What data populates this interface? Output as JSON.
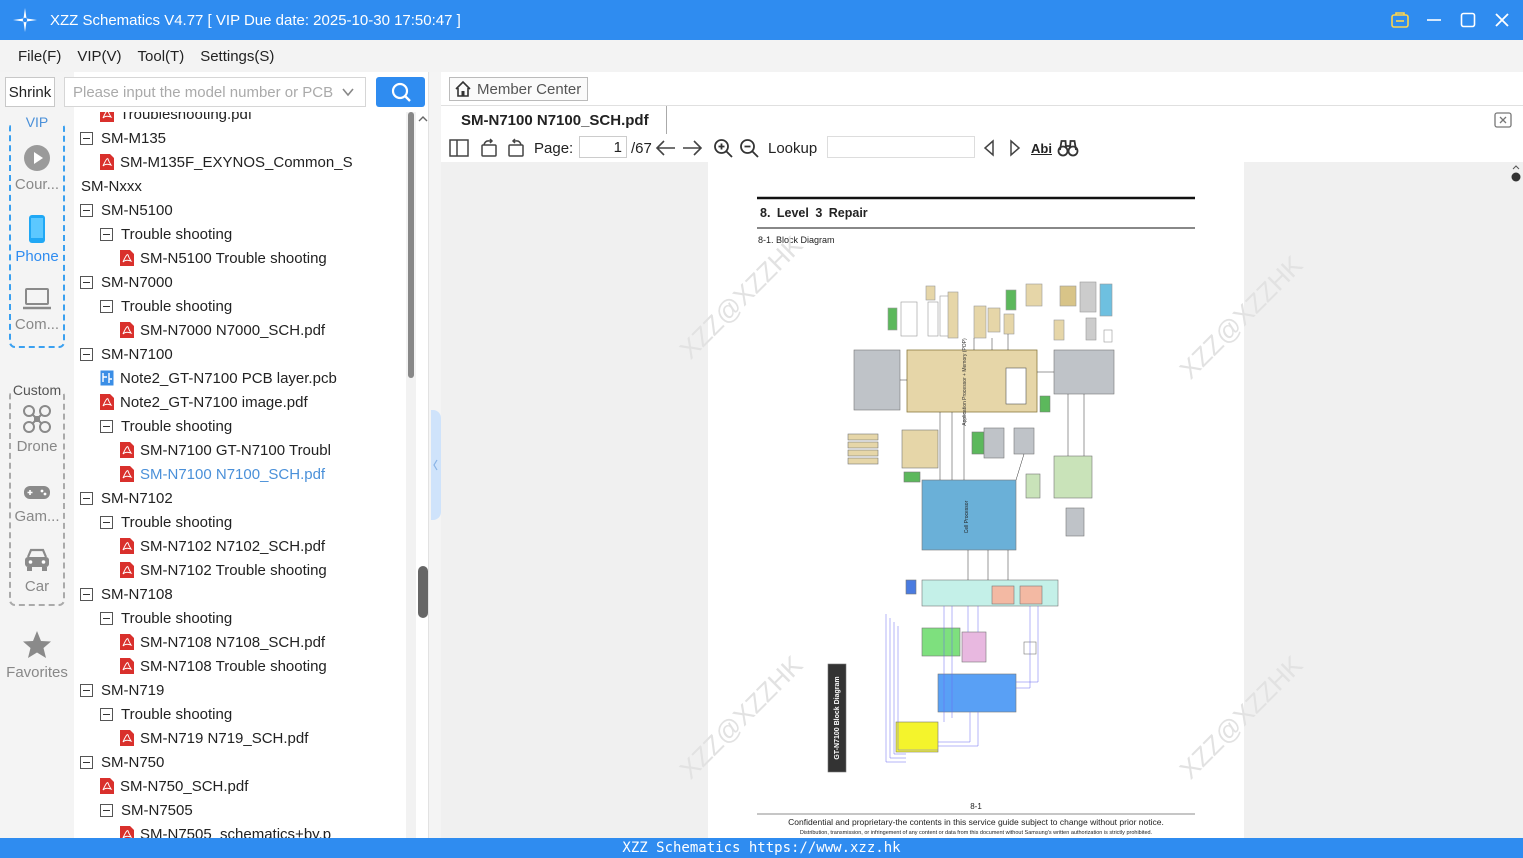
{
  "app": {
    "title": "XZZ Schematics V4.77 [ VIP Due date: 2025-10-30 17:50:47 ]"
  },
  "menu": [
    "File(F)",
    "VIP(V)",
    "Tool(T)",
    "Settings(S)"
  ],
  "rail": {
    "shrink_label": "Shrink",
    "vip_label": "VIP",
    "custom_label": "Custom",
    "items": [
      {
        "label": "Cour...",
        "icon": "play-circle-icon"
      },
      {
        "label": "Phone",
        "icon": "phone-icon"
      },
      {
        "label": "Com...",
        "icon": "laptop-icon"
      },
      {
        "label": "Drone",
        "icon": "drone-icon"
      },
      {
        "label": "Gam...",
        "icon": "gamepad-icon"
      },
      {
        "label": "Car",
        "icon": "car-icon"
      },
      {
        "label": "Favorites",
        "icon": "star-icon"
      }
    ]
  },
  "search": {
    "placeholder": "Please input the model number or PCB"
  },
  "tree": [
    {
      "label": "Troubleshooting.pdf",
      "type": "pdf"
    },
    {
      "label": "SM-M135",
      "type": "folder"
    },
    {
      "label": "SM-M135F_EXYNOS_Common_S",
      "type": "pdf"
    },
    {
      "label": "SM-Nxxx",
      "type": "folder"
    },
    {
      "label": "SM-N5100",
      "type": "folder"
    },
    {
      "label": "Trouble shooting",
      "type": "folder"
    },
    {
      "label": "SM-N5100 Trouble shooting",
      "type": "pdf"
    },
    {
      "label": "SM-N7000",
      "type": "folder"
    },
    {
      "label": "Trouble shooting",
      "type": "folder"
    },
    {
      "label": "SM-N7000 N7000_SCH.pdf",
      "type": "pdf"
    },
    {
      "label": "SM-N7100",
      "type": "folder"
    },
    {
      "label": "Note2_GT-N7100 PCB layer.pcb",
      "type": "pcb"
    },
    {
      "label": "Note2_GT-N7100 image.pdf",
      "type": "pdf"
    },
    {
      "label": "Trouble shooting",
      "type": "folder"
    },
    {
      "label": "SM-N7100 GT-N7100 Troubl",
      "type": "pdf"
    },
    {
      "label": "SM-N7100 N7100_SCH.pdf",
      "type": "pdf",
      "selected": true
    },
    {
      "label": "SM-N7102",
      "type": "folder"
    },
    {
      "label": "Trouble shooting",
      "type": "folder"
    },
    {
      "label": "SM-N7102 N7102_SCH.pdf",
      "type": "pdf"
    },
    {
      "label": "SM-N7102 Trouble shooting",
      "type": "pdf"
    },
    {
      "label": "SM-N7108",
      "type": "folder"
    },
    {
      "label": "Trouble shooting",
      "type": "folder"
    },
    {
      "label": "SM-N7108 N7108_SCH.pdf",
      "type": "pdf"
    },
    {
      "label": "SM-N7108 Trouble shooting",
      "type": "pdf"
    },
    {
      "label": "SM-N719",
      "type": "folder"
    },
    {
      "label": "Trouble shooting",
      "type": "folder"
    },
    {
      "label": "SM-N719 N719_SCH.pdf",
      "type": "pdf"
    },
    {
      "label": "SM-N750",
      "type": "folder"
    },
    {
      "label": "SM-N750_SCH.pdf",
      "type": "pdf"
    },
    {
      "label": "SM-N7505",
      "type": "folder"
    },
    {
      "label": "SM-N7505_schematics+by.p",
      "type": "pdf"
    }
  ],
  "member_center": "Member Center",
  "doc_tab": "SM-N7100 N7100_SCH.pdf",
  "toolbar": {
    "page_label": "Page:",
    "page_value": "1",
    "page_total": "/67",
    "lookup_label": "Lookup",
    "abi_label": "Abi"
  },
  "document": {
    "heading": "8.  Level  3  Repair",
    "subheading": "8-1. Block Diagram",
    "side_title": "GT-N7100 Block Diagram",
    "ap_label": "Application Processor + Memory (POP)",
    "cp_label": "Cell Processor",
    "page_number": "8-1",
    "footer1": "Confidential and proprietary-the contents in this service guide subject to change without prior notice.",
    "footer2": "Distribution, transmission, or infringement of any content or data from this document without Samsung's written authorization is strictly prohibited.",
    "watermark": "XZZ@XZZHK"
  },
  "statusbar": "XZZ Schematics https://www.xzz.hk",
  "colors": {
    "accent": "#2f8cf0",
    "pdf_red": "#d9302c",
    "selected": "#4a90d9"
  }
}
